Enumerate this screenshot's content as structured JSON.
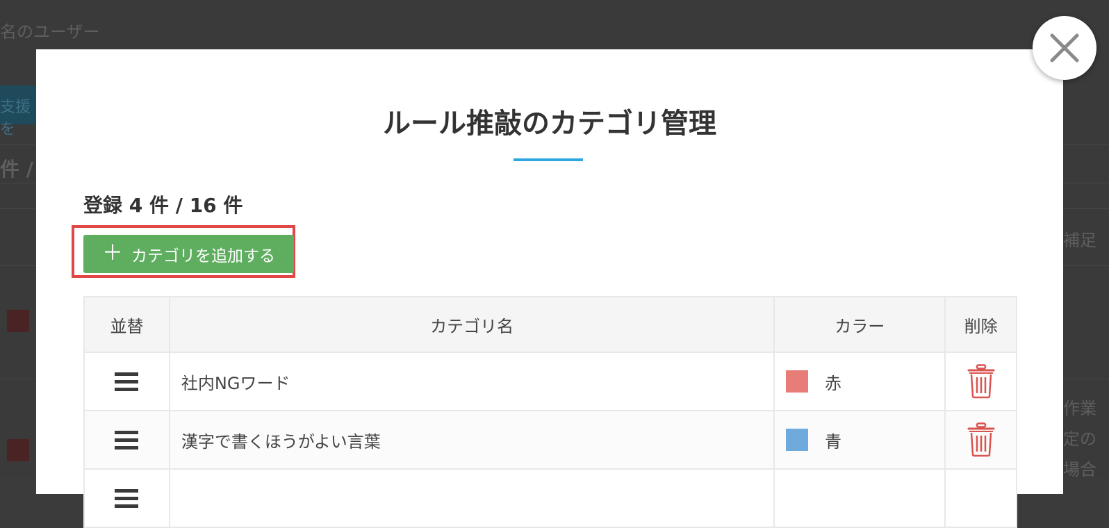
{
  "background": {
    "users_text": "名のユーザー",
    "support_button": "支援を",
    "count_text": "件 /",
    "supplement": "補足",
    "line1": "作業",
    "line2": "定の",
    "line3": "場合"
  },
  "modal": {
    "title": "ルール推敲のカテゴリ管理",
    "registered": "登録 4 件 / 16 件",
    "add_button_label": "カテゴリを追加する",
    "accent_color": "#2ea7e0",
    "add_button_color": "#5fae60",
    "highlight_color": "#e04848"
  },
  "table": {
    "headers": {
      "sort": "並替",
      "name": "カテゴリ名",
      "color": "カラー",
      "delete": "削除"
    },
    "rows": [
      {
        "name": "社内NGワード",
        "color_label": "赤",
        "swatch": "#e87c77",
        "icons": [
          "drag-handle-icon",
          "trash-icon"
        ]
      },
      {
        "name": "漢字で書くほうがよい言葉",
        "color_label": "青",
        "swatch": "#6eaadb",
        "icons": [
          "drag-handle-icon",
          "trash-icon"
        ]
      },
      {
        "name": "",
        "color_label": "",
        "swatch": "",
        "icons": [
          "drag-handle-icon",
          "trash-icon"
        ]
      }
    ]
  },
  "icons": {
    "close": "close-icon",
    "plus": "plus-icon",
    "sort": "drag-handle-icon",
    "delete": "trash-icon"
  }
}
